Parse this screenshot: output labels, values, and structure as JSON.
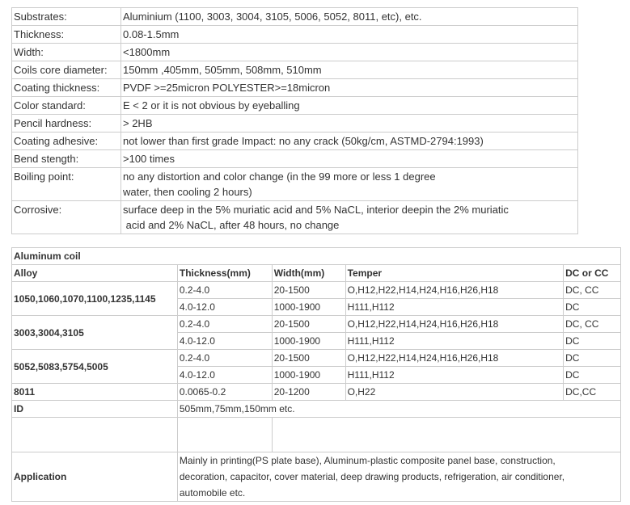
{
  "specs": [
    {
      "label": "Substrates:",
      "value": "Aluminium (1100, 3003, 3004, 3105, 5006, 5052, 8011, etc), etc."
    },
    {
      "label": "Thickness:",
      "value": "0.08-1.5mm"
    },
    {
      "label": "Width:",
      "value": "<1800mm"
    },
    {
      "label": "Coils core diameter:",
      "value": "150mm ,405mm, 505mm, 508mm, 510mm"
    },
    {
      "label": "Coating thickness:",
      "value": "PVDF >=25micron POLYESTER>=18micron"
    },
    {
      "label": "Color standard:",
      "value": "E < 2 or it is not obvious by eyeballing"
    },
    {
      "label": "Pencil hardness:",
      "value": "> 2HB"
    },
    {
      "label": "Coating adhesive:",
      "value": "not lower than first grade Impact: no any crack (50kg/cm, ASTMD-2794:1993)"
    },
    {
      "label": "Bend stength:",
      "value": ">100 times"
    },
    {
      "label": "Boiling point:",
      "value_line1": "no any distortion and color change (in the 99 more or less 1 degree",
      "value_line2": "water, then cooling 2 hours)"
    },
    {
      "label": "Corrosive:",
      "value_line1": "surface deep in the 5% muriatic acid and 5% NaCL, interior deepin the 2% muriatic",
      "value_line2": " acid and 2% NaCL, after 48 hours, no change"
    }
  ],
  "coil": {
    "title": "Aluminum coil",
    "headers": {
      "alloy": "Alloy",
      "thickness": "Thickness(mm)",
      "width": "Width(mm)",
      "temper": "Temper",
      "dc": "DC or CC"
    },
    "groups": [
      {
        "alloy": "1050,1060,1070,1100,1235,1145",
        "rows": [
          {
            "thickness": "0.2-4.0",
            "width": "20-1500",
            "temper": "O,H12,H22,H14,H24,H16,H26,H18",
            "dc": "DC, CC"
          },
          {
            "thickness": "4.0-12.0",
            "width": "1000-1900",
            "temper": "H111,H112",
            "dc": "DC"
          }
        ]
      },
      {
        "alloy": "3003,3004,3105",
        "rows": [
          {
            "thickness": "0.2-4.0",
            "width": "20-1500",
            "temper": "O,H12,H22,H14,H24,H16,H26,H18",
            "dc": "DC, CC"
          },
          {
            "thickness": "4.0-12.0",
            "width": "1000-1900",
            "temper": "H111,H112",
            "dc": "DC"
          }
        ]
      },
      {
        "alloy": "5052,5083,5754,5005",
        "rows": [
          {
            "thickness": "0.2-4.0",
            "width": "20-1500",
            "temper": "O,H12,H22,H14,H24,H16,H26,H18",
            "dc": "DC"
          },
          {
            "thickness": "4.0-12.0",
            "width": "1000-1900",
            "temper": "H111,H112",
            "dc": "DC"
          }
        ]
      }
    ],
    "row8011": {
      "alloy": "8011",
      "thickness": "0.0065-0.2",
      "width": "20-1200",
      "temper": "O,H22",
      "dc": "DC,CC"
    },
    "id": {
      "label": "ID",
      "value": "505mm,75mm,150mm etc."
    },
    "application": {
      "label": "Application",
      "line1": "Mainly in printing(PS plate base), Aluminum-plastic composite panel base, construction,",
      "line2": "decoration, capacitor, cover material, deep drawing products, refrigeration, air conditioner,",
      "line3": "automobile etc."
    }
  }
}
